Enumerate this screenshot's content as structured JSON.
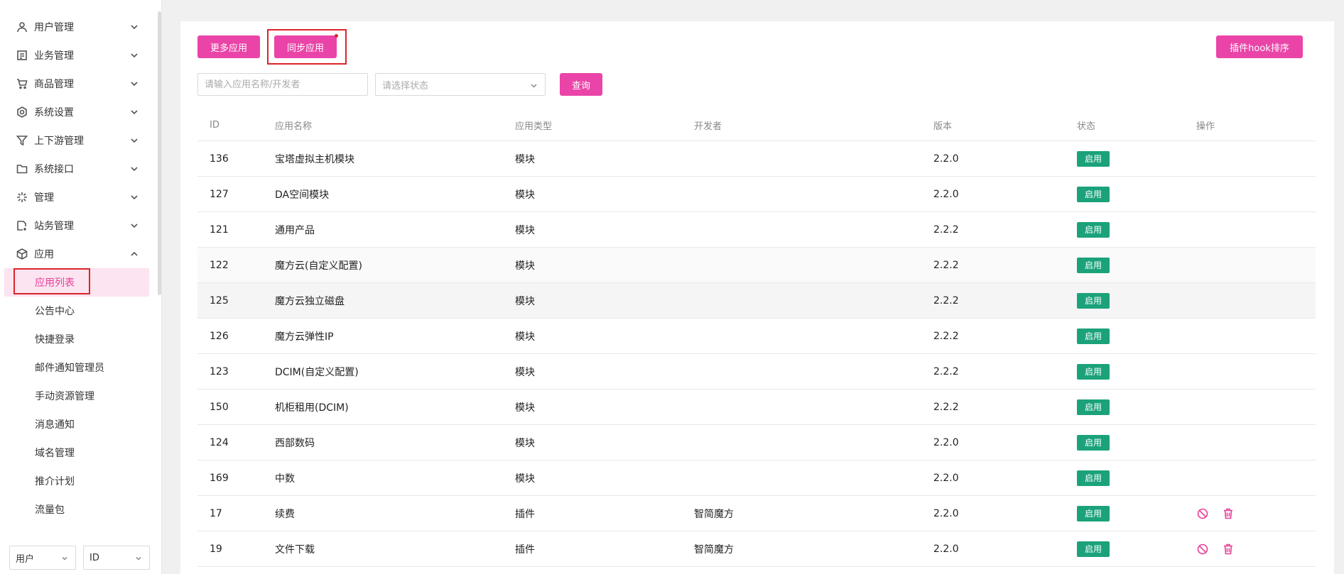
{
  "sidebar": {
    "menu": [
      {
        "label": "用户管理",
        "icon": "user-icon",
        "expanded": false
      },
      {
        "label": "业务管理",
        "icon": "document-icon",
        "expanded": false
      },
      {
        "label": "商品管理",
        "icon": "cart-icon",
        "expanded": false
      },
      {
        "label": "系统设置",
        "icon": "gear-icon",
        "expanded": false
      },
      {
        "label": "上下游管理",
        "icon": "filter-icon",
        "expanded": false
      },
      {
        "label": "系统接口",
        "icon": "folder-icon",
        "expanded": false
      },
      {
        "label": "管理",
        "icon": "sparkle-icon",
        "expanded": false
      },
      {
        "label": "站务管理",
        "icon": "file-add-icon",
        "expanded": false
      },
      {
        "label": "应用",
        "icon": "cube-icon",
        "expanded": true
      }
    ],
    "submenu": [
      {
        "label": "应用列表",
        "active": true
      },
      {
        "label": "公告中心",
        "active": false
      },
      {
        "label": "快捷登录",
        "active": false
      },
      {
        "label": "邮件通知管理员",
        "active": false
      },
      {
        "label": "手动资源管理",
        "active": false
      },
      {
        "label": "消息通知",
        "active": false
      },
      {
        "label": "域名管理",
        "active": false
      },
      {
        "label": "推介计划",
        "active": false
      },
      {
        "label": "流量包",
        "active": false
      }
    ],
    "bottom": {
      "select1": "用户",
      "select2": "ID"
    }
  },
  "toolbar": {
    "more_apps": "更多应用",
    "sync_apps": "同步应用",
    "hook_sort": "插件hook排序"
  },
  "search": {
    "keyword_placeholder": "请输入应用名称/开发者",
    "status_placeholder": "请选择状态",
    "query_label": "查询"
  },
  "table": {
    "headers": {
      "id": "ID",
      "name": "应用名称",
      "type": "应用类型",
      "developer": "开发者",
      "version": "版本",
      "status": "状态",
      "ops": "操作"
    },
    "rows": [
      {
        "id": "136",
        "name": "宝塔虚拟主机模块",
        "type": "模块",
        "developer": "",
        "version": "2.2.0",
        "status": "启用",
        "ops": false
      },
      {
        "id": "127",
        "name": "DA空间模块",
        "type": "模块",
        "developer": "",
        "version": "2.2.0",
        "status": "启用",
        "ops": false
      },
      {
        "id": "121",
        "name": "通用产品",
        "type": "模块",
        "developer": "",
        "version": "2.2.2",
        "status": "启用",
        "ops": false
      },
      {
        "id": "122",
        "name": "魔方云(自定义配置)",
        "type": "模块",
        "developer": "",
        "version": "2.2.2",
        "status": "启用",
        "ops": false
      },
      {
        "id": "125",
        "name": "魔方云独立磁盘",
        "type": "模块",
        "developer": "",
        "version": "2.2.2",
        "status": "启用",
        "ops": false
      },
      {
        "id": "126",
        "name": "魔方云弹性IP",
        "type": "模块",
        "developer": "",
        "version": "2.2.2",
        "status": "启用",
        "ops": false
      },
      {
        "id": "123",
        "name": "DCIM(自定义配置)",
        "type": "模块",
        "developer": "",
        "version": "2.2.2",
        "status": "启用",
        "ops": false
      },
      {
        "id": "150",
        "name": "机柜租用(DCIM)",
        "type": "模块",
        "developer": "",
        "version": "2.2.2",
        "status": "启用",
        "ops": false
      },
      {
        "id": "124",
        "name": "西部数码",
        "type": "模块",
        "developer": "",
        "version": "2.2.0",
        "status": "启用",
        "ops": false
      },
      {
        "id": "169",
        "name": "中数",
        "type": "模块",
        "developer": "",
        "version": "2.2.0",
        "status": "启用",
        "ops": false
      },
      {
        "id": "17",
        "name": "续费",
        "type": "插件",
        "developer": "智简魔方",
        "version": "2.2.0",
        "status": "启用",
        "ops": true
      },
      {
        "id": "19",
        "name": "文件下载",
        "type": "插件",
        "developer": "智简魔方",
        "version": "2.2.0",
        "status": "启用",
        "ops": true
      }
    ]
  },
  "colors": {
    "accent": "#ea44a8",
    "status_green": "#1ba27a",
    "highlight_red": "#d9252b"
  }
}
